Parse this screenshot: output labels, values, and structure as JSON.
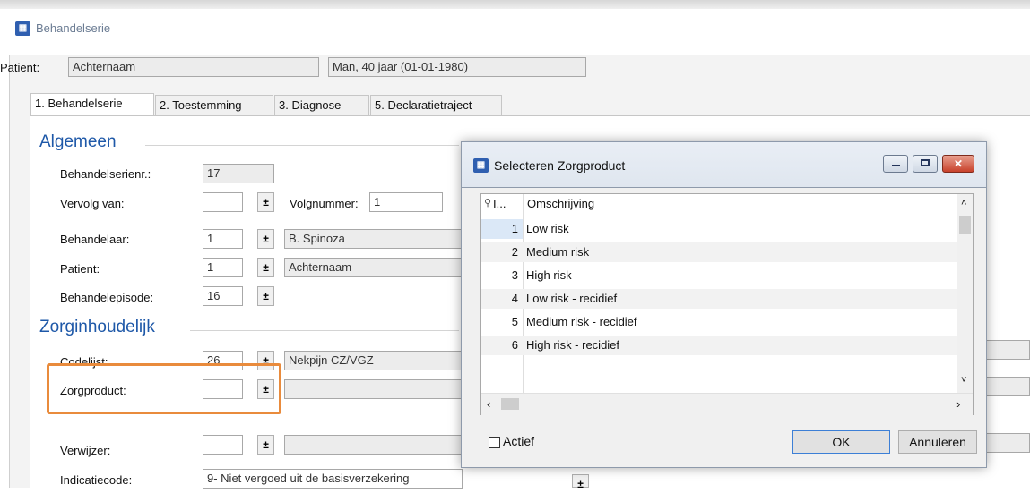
{
  "window": {
    "title": "Behandelserie"
  },
  "patient_bar": {
    "label": "Patient:",
    "name": "Achternaam",
    "info": "Man, 40 jaar (01-01-1980)"
  },
  "tabs": [
    "1. Behandelserie",
    "2. Toestemming",
    "3. Diagnose",
    "5. Declaratietraject"
  ],
  "sections": {
    "general": "Algemeen",
    "care": "Zorginhoudelijk"
  },
  "form": {
    "behandelserienr_label": "Behandelserienr.:",
    "behandelserienr_value": "17",
    "vervolg_label": "Vervolg van:",
    "vervolg_value": "",
    "volgnummer_label": "Volgnummer:",
    "volgnummer_value": "1",
    "behandelaar_label": "Behandelaar:",
    "behandelaar_code": "1",
    "behandelaar_name": "B. Spinoza",
    "patient_label": "Patient:",
    "patient_code": "1",
    "patient_name": "Achternaam",
    "behandelepisode_label": "Behandelepisode:",
    "behandelepisode_value": "16",
    "codelijst_label": "Codelijst:",
    "codelijst_code": "26",
    "codelijst_name": "Nekpijn CZ/VGZ",
    "zorgproduct_label": "Zorgproduct:",
    "zorgproduct_value": "",
    "verwijzer_label": "Verwijzer:",
    "verwijzer_value": "",
    "indicatiecode_label": "Indicatiecode:",
    "indicatiecode_value": "9- Niet vergoed uit de basisverzekering"
  },
  "stepper_glyph": "±",
  "dialog": {
    "title": "Selecteren Zorgproduct",
    "col_id": "I...",
    "col_desc": "Omschrijving",
    "rows": [
      {
        "id": "1",
        "desc": "Low risk"
      },
      {
        "id": "2",
        "desc": "Medium risk"
      },
      {
        "id": "3",
        "desc": "High risk"
      },
      {
        "id": "4",
        "desc": "Low risk - recidief"
      },
      {
        "id": "5",
        "desc": "Medium risk - recidief"
      },
      {
        "id": "6",
        "desc": "High risk - recidief"
      }
    ],
    "actief_label": "Actief",
    "ok_label": "OK",
    "cancel_label": "Annuleren"
  }
}
